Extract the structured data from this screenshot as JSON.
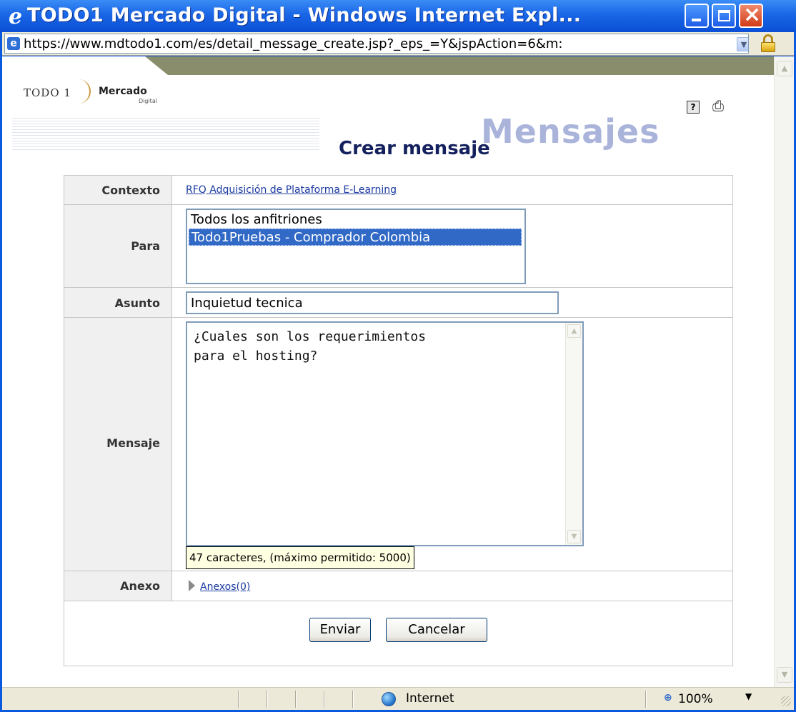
{
  "window": {
    "title": "TODO1 Mercado Digital - Windows Internet Expl...",
    "title_icon": "ie-icon",
    "controls": {
      "minimize": "minimize-button",
      "maximize": "maximize-button",
      "close": "close-button"
    }
  },
  "address": {
    "url": "https://www.mdtodo1.com/es/detail_message_create.jsp?_eps_=Y&jspAction=6&m:",
    "icons": [
      "ie-page-icon",
      "dropdown-icon",
      "lock-icon"
    ]
  },
  "brand": {
    "todo1": "TODO 1",
    "mercado": "Mercado",
    "digital": "Digital",
    "band_color": "#8a8d6b"
  },
  "toolbar_icons": [
    "help-icon",
    "print-icon"
  ],
  "page": {
    "section": "Mensajes",
    "title": "Crear mensaje"
  },
  "form": {
    "contexto": {
      "label": "Contexto",
      "value": "RFQ Adquisición de Plataforma E-Learning"
    },
    "para": {
      "label": "Para",
      "options": [
        "Todos los anfitriones",
        "Todo1Pruebas - Comprador Colombia"
      ],
      "selected_index": 1
    },
    "asunto": {
      "label": "Asunto",
      "value": "Inquietud tecnica"
    },
    "mensaje": {
      "label": "Mensaje",
      "value": "¿Cuales son los requerimientos\npara el hosting?",
      "counter": "47 caracteres, (máximo permitido: 5000)"
    },
    "anexo": {
      "label": "Anexo",
      "link": "Anexos(0)"
    },
    "buttons": {
      "send": "Enviar",
      "cancel": "Cancelar"
    }
  },
  "status": {
    "zone": "Internet",
    "zoom": "100%"
  },
  "colors": {
    "title_bar": "#1a66e6",
    "selection": "#3169c6",
    "link": "#1a3aa0",
    "title_text": "#14215e",
    "watermark": "#aab4db"
  }
}
